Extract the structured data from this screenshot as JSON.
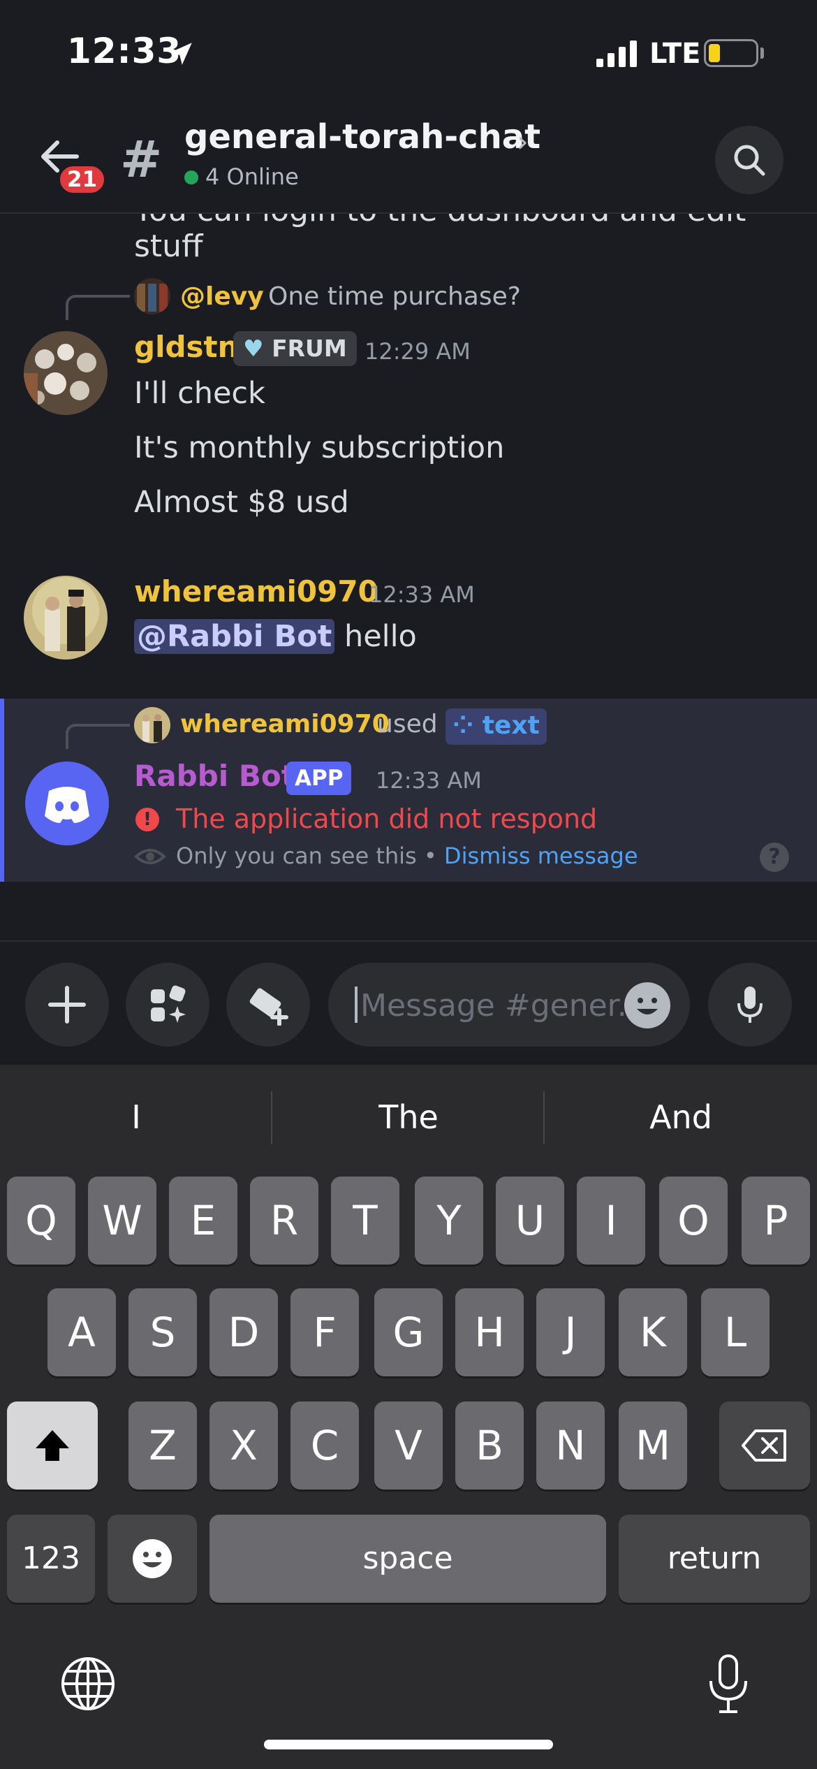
{
  "status": {
    "time": "12:33",
    "network": "LTE"
  },
  "header": {
    "badge": "21",
    "hash": "#",
    "channel": "general-torah-chat",
    "online": "4 Online"
  },
  "messages": {
    "cut_text": "You can login to the dashboard and edit stuff",
    "m1": {
      "reply_user": "@levy",
      "reply_text": "One time purchase?",
      "user": "gldstn",
      "role": "FRUM",
      "time": "12:29 AM",
      "lines": [
        "I'll check",
        "It's monthly subscription",
        "Almost $8 usd"
      ]
    },
    "m2": {
      "user": "whereami0970",
      "time": "12:33 AM",
      "mention": "@Rabbi Bot",
      "text": "hello"
    },
    "m3": {
      "used_user": "whereami0970",
      "used_word": "used",
      "command": "text",
      "user": "Rabbi Bot",
      "app_tag": "APP",
      "time": "12:33 AM",
      "error": "The application did not respond",
      "ephemeral": "Only you can see this",
      "separator": "•",
      "dismiss": "Dismiss message",
      "help": "?"
    }
  },
  "composer": {
    "placeholder": "Message #gener..."
  },
  "keyboard": {
    "suggestions": [
      "I",
      "The",
      "And"
    ],
    "row1": [
      "Q",
      "W",
      "E",
      "R",
      "T",
      "Y",
      "U",
      "I",
      "O",
      "P"
    ],
    "row2": [
      "A",
      "S",
      "D",
      "F",
      "G",
      "H",
      "J",
      "K",
      "L"
    ],
    "row3": [
      "Z",
      "X",
      "C",
      "V",
      "B",
      "N",
      "M"
    ],
    "numbers": "123",
    "space": "space",
    "return": "return"
  },
  "colors": {
    "username_yellow": "#f0c33c",
    "bot_purple": "#b65bd0",
    "blurple": "#5865f2",
    "error_red": "#f0484b",
    "link_blue": "#4fa3f7"
  },
  "icons": [
    "location-arrow-icon",
    "signal-icon",
    "battery-icon",
    "back-arrow-icon",
    "search-icon",
    "plus-icon",
    "apps-icon",
    "gift-icon",
    "emoji-icon",
    "mic-icon",
    "shift-icon",
    "backspace-icon",
    "globe-icon",
    "dictation-icon",
    "eye-icon",
    "discord-logo-icon"
  ]
}
